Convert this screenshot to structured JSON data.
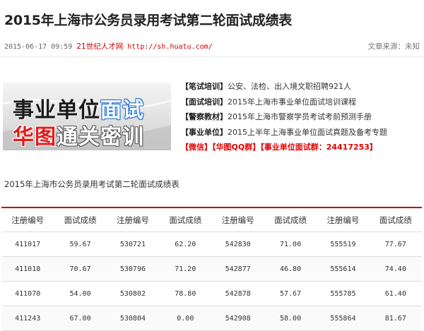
{
  "article": {
    "title": "2015年上海市公务员录用考试第二轮面试成绩表",
    "date": "2015-06-17 09:59",
    "source_name": "21世纪人才网",
    "source_url": "http://sh.huatu.com/",
    "source_label": "文章来源：未知"
  },
  "banner": {
    "line1_prefix": "事业单位",
    "line1_highlight": "面试",
    "line2_red": "华图",
    "line2_rest": "通关密训"
  },
  "links": [
    {
      "tag": "【笔试培训】",
      "text": "公安、法检、出入境文职招聘921人"
    },
    {
      "tag": "【面试培训】",
      "text": "2015年上海市事业单位面试培训课程"
    },
    {
      "tag": "【警察教材】",
      "text": "2015年上海市警察学员考试考前预测手册"
    },
    {
      "tag": "【事业单位】",
      "text": "2015上半年上海事业单位面试真题及备考专题"
    }
  ],
  "promo": "【微信】【华图QQ群】【事业单位面试群：24417253】",
  "table_caption": "2015年上海市公务员录用考试第二轮面试成绩表",
  "table": {
    "headers": [
      "注册编号",
      "面试成绩",
      "注册编号",
      "面试成绩",
      "注册编号",
      "面试成绩",
      "注册编号",
      "面试成绩"
    ],
    "rows": [
      [
        "411017",
        "59.67",
        "530721",
        "62.20",
        "542830",
        "71.00",
        "555519",
        "77.67"
      ],
      [
        "411018",
        "70.67",
        "530796",
        "71.20",
        "542877",
        "46.80",
        "555614",
        "74.40"
      ],
      [
        "411070",
        "54.00",
        "530802",
        "78.80",
        "542878",
        "57.67",
        "555785",
        "61.40"
      ],
      [
        "411243",
        "67.00",
        "530804",
        "0.00",
        "542908",
        "58.00",
        "555864",
        "81.67"
      ]
    ]
  },
  "colors": {
    "accent": "#c40000",
    "link_red": "#e00000"
  }
}
